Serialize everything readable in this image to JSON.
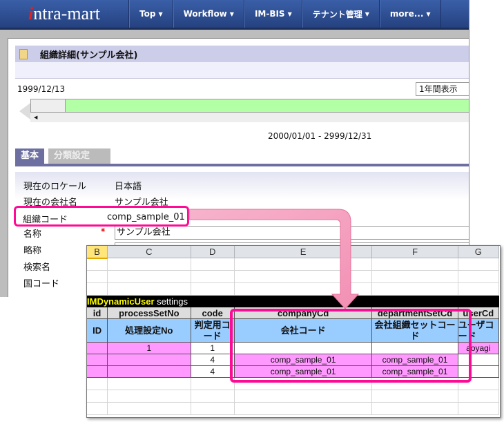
{
  "nav": {
    "logo": "intra-mart",
    "items": [
      "Top",
      "Workflow",
      "IM-BIS",
      "テナント管理",
      "more..."
    ]
  },
  "page": {
    "title": "組織詳細(サンプル会社)",
    "date": "1999/12/13",
    "period_select": "1年間表示",
    "range": "2000/01/01 - 2999/12/31",
    "tabs": [
      "基本",
      "分類設定"
    ]
  },
  "form": {
    "rows": [
      {
        "label": "現在のロケール",
        "value": "日本語"
      },
      {
        "label": "現在の会社名",
        "value": "サンプル会社"
      },
      {
        "label": "組織コード",
        "value": "comp_sample_01"
      },
      {
        "label": "名称",
        "value": "サンプル会社",
        "required": "*"
      },
      {
        "label": "略称",
        "value": ""
      },
      {
        "label": "検索名",
        "value": ""
      },
      {
        "label": "国コード",
        "value": ""
      }
    ]
  },
  "sheet": {
    "columns": [
      "B",
      "C",
      "D",
      "E",
      "F",
      "G"
    ],
    "banner_bold": "IMDynamicUser",
    "banner_rest": " settings",
    "fields": [
      "id",
      "processSetNo",
      "code",
      "companyCd",
      "departmentSetCd",
      "userCd"
    ],
    "labels": [
      "ID",
      "処理設定No",
      "判定用コード",
      "会社コード",
      "会社組織セットコード",
      "ユーザコード"
    ],
    "rows": [
      [
        "",
        "1",
        "1",
        "",
        "",
        "aoyagi"
      ],
      [
        "",
        "",
        "4",
        "comp_sample_01",
        "comp_sample_01",
        ""
      ],
      [
        "",
        "",
        "4",
        "comp_sample_01",
        "comp_sample_01",
        ""
      ]
    ]
  },
  "colors": {
    "highlight": "#ff0a96",
    "key_row": "#ff99ff",
    "label_row": "#99ccff",
    "timeline": "#b3ffa6"
  }
}
